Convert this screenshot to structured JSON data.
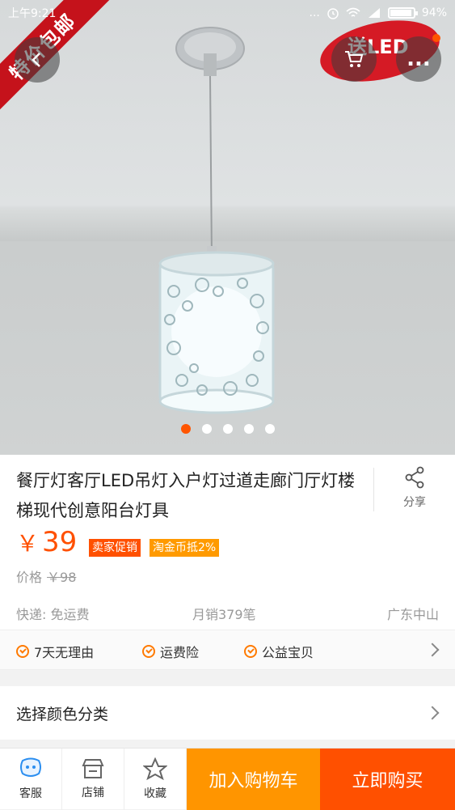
{
  "status_bar": {
    "time": "上午9:21",
    "dots": "...",
    "battery": "94%",
    "battery_level": 0.94
  },
  "hero": {
    "ribbon": "特价包邮",
    "promo": "送LED",
    "more_label": "...",
    "carousel": {
      "count": 5,
      "active": 0
    }
  },
  "product": {
    "title": "餐厅灯客厅LED吊灯入户灯过道走廊门厅灯楼梯现代创意阳台灯具",
    "share_label": "分享",
    "currency": "￥",
    "price": "39",
    "tags": [
      "卖家促销",
      "淘金币抵2%"
    ],
    "original_price_label": "价格",
    "original_price": "￥98",
    "shipping": "快递: 免运费",
    "sales": "月销379笔",
    "location": "广东中山"
  },
  "guarantees": [
    "7天无理由",
    "运费险",
    "公益宝贝"
  ],
  "sku": {
    "label": "选择颜色分类"
  },
  "bottom": {
    "service": "客服",
    "shop": "店铺",
    "favorite": "收藏",
    "add_to_cart": "加入购物车",
    "buy_now": "立即购买"
  },
  "colors": {
    "accent": "#ff5000",
    "cart_button": "#ff9500",
    "ribbon": "#c5121b",
    "check": "#ff7a00"
  }
}
